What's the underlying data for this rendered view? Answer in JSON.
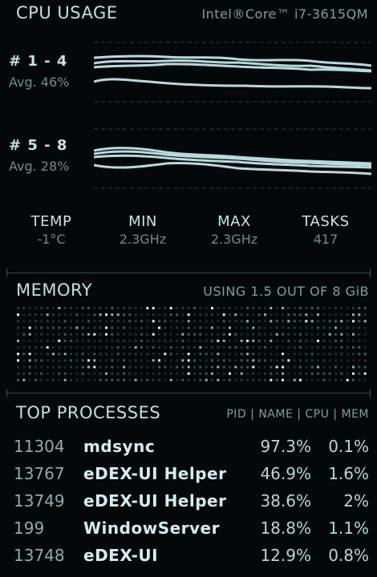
{
  "cpu": {
    "title": "CPU USAGE",
    "model": "Intel®Core™ i7-3615QM",
    "groups": [
      {
        "label": "# 1 - 4",
        "avg": "Avg. 46%"
      },
      {
        "label": "# 5 - 8",
        "avg": "Avg. 28%"
      }
    ],
    "stats": [
      {
        "label": "TEMP",
        "value": "-1°C"
      },
      {
        "label": "MIN",
        "value": "2.3GHz"
      },
      {
        "label": "MAX",
        "value": "2.3GHz"
      },
      {
        "label": "TASKS",
        "value": "417"
      }
    ]
  },
  "memory": {
    "title": "MEMORY",
    "usage": "USING 1.5 OUT OF 8 GiB"
  },
  "processes": {
    "title": "TOP PROCESSES",
    "columns": "PID | NAME | CPU | MEM",
    "rows": [
      {
        "pid": "11304",
        "name": "mdsync",
        "cpu": "97.3%",
        "mem": "0.1%"
      },
      {
        "pid": "13767",
        "name": "eDEX-UI Helper",
        "cpu": "46.9%",
        "mem": "1.6%"
      },
      {
        "pid": "13749",
        "name": "eDEX-UI Helper",
        "cpu": "38.6%",
        "mem": "2%"
      },
      {
        "pid": "199",
        "name": "WindowServer",
        "cpu": "18.8%",
        "mem": "1.1%"
      },
      {
        "pid": "13748",
        "name": "eDEX-UI",
        "cpu": "12.9%",
        "mem": "0.8%"
      }
    ]
  },
  "colors": {
    "background": "#05080a",
    "accent": "#aacfd1",
    "line": "#b8dadc",
    "dim": "#6d8d8f"
  }
}
